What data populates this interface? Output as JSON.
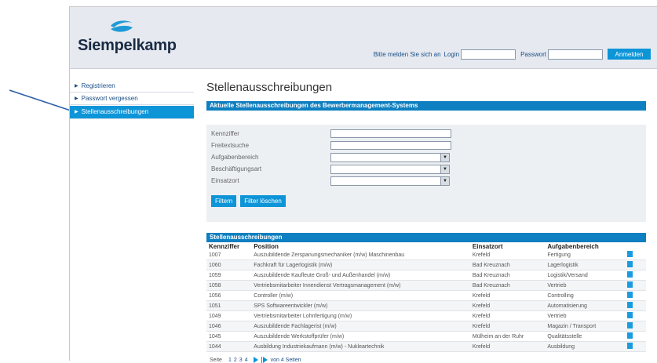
{
  "brand": {
    "name": "Siempelkamp"
  },
  "login": {
    "prompt": "Bitte melden Sie sich an",
    "login_label": "Login",
    "password_label": "Passwort",
    "login_value": "",
    "password_value": "",
    "button": "Anmelden"
  },
  "sidebar": {
    "items": [
      {
        "label": "Registrieren"
      },
      {
        "label": "Passwort vergessen"
      },
      {
        "label": "Stellenausschreibungen"
      }
    ]
  },
  "main": {
    "title": "Stellenausschreibungen",
    "subtitle": "Aktuelle Stellenausschreibungen des Bewerbermanagement-Systems"
  },
  "filter": {
    "fields": [
      {
        "label": "Kennziffer",
        "value": ""
      },
      {
        "label": "Freitextsuche",
        "value": ""
      },
      {
        "label": "Aufgabenbereich",
        "value": ""
      },
      {
        "label": "Beschäftigungsart",
        "value": ""
      },
      {
        "label": "Einsatzort",
        "value": ""
      }
    ],
    "filter_button": "Filtern",
    "clear_button": "Filter löschen"
  },
  "results": {
    "title": "Stellenausschreibungen",
    "columns": [
      "Kennziffer",
      "Position",
      "Einsatzort",
      "Aufgabenbereich"
    ],
    "rows": [
      [
        "1007",
        "Auszubildende Zerspanungsmechaniker (m/w) Maschinenbau",
        "Krefeld",
        "Fertigung"
      ],
      [
        "1060",
        "Fachkraft für Lagerlogistik (m/w)",
        "Bad Kreuznach",
        "Lagerlogistik"
      ],
      [
        "1059",
        "Auszubildende Kaufleute Groß- und Außenhandel (m/w)",
        "Bad Kreuznach",
        "Logistik/Versand"
      ],
      [
        "1058",
        "Vertriebsmitarbeiter Innendienst Vertragsmanagement (m/w)",
        "Bad Kreuznach",
        "Vertrieb"
      ],
      [
        "1056",
        "Controller (m/w)",
        "Krefeld",
        "Controlling"
      ],
      [
        "1051",
        "SPS Softwareentwickler (m/w)",
        "Krefeld",
        "Automatisierung"
      ],
      [
        "1049",
        "Vertriebsmitarbeiter Lohnfertigung (m/w)",
        "Krefeld",
        "Vertrieb"
      ],
      [
        "1046",
        "Auszubildende Fachlagerist (m/w)",
        "Krefeld",
        "Magazin / Transport"
      ],
      [
        "1045",
        "Auszubildende Werkstoffprüfer (m/w)",
        "Mülheim an der Ruhr",
        "Qualitätsstelle"
      ],
      [
        "1044",
        "Ausbildung Industriekaufmann (m/w) - Nukleartechnik",
        "Krefeld",
        "Ausbildung"
      ]
    ],
    "pager": {
      "label": "Seite",
      "pages": [
        "1",
        "2",
        "3",
        "4"
      ],
      "summary": "von 4 Seiten"
    }
  },
  "colors": {
    "accent": "#0d95d8",
    "header_bg": "#e6eaf0",
    "bar": "#0e7fc0"
  }
}
